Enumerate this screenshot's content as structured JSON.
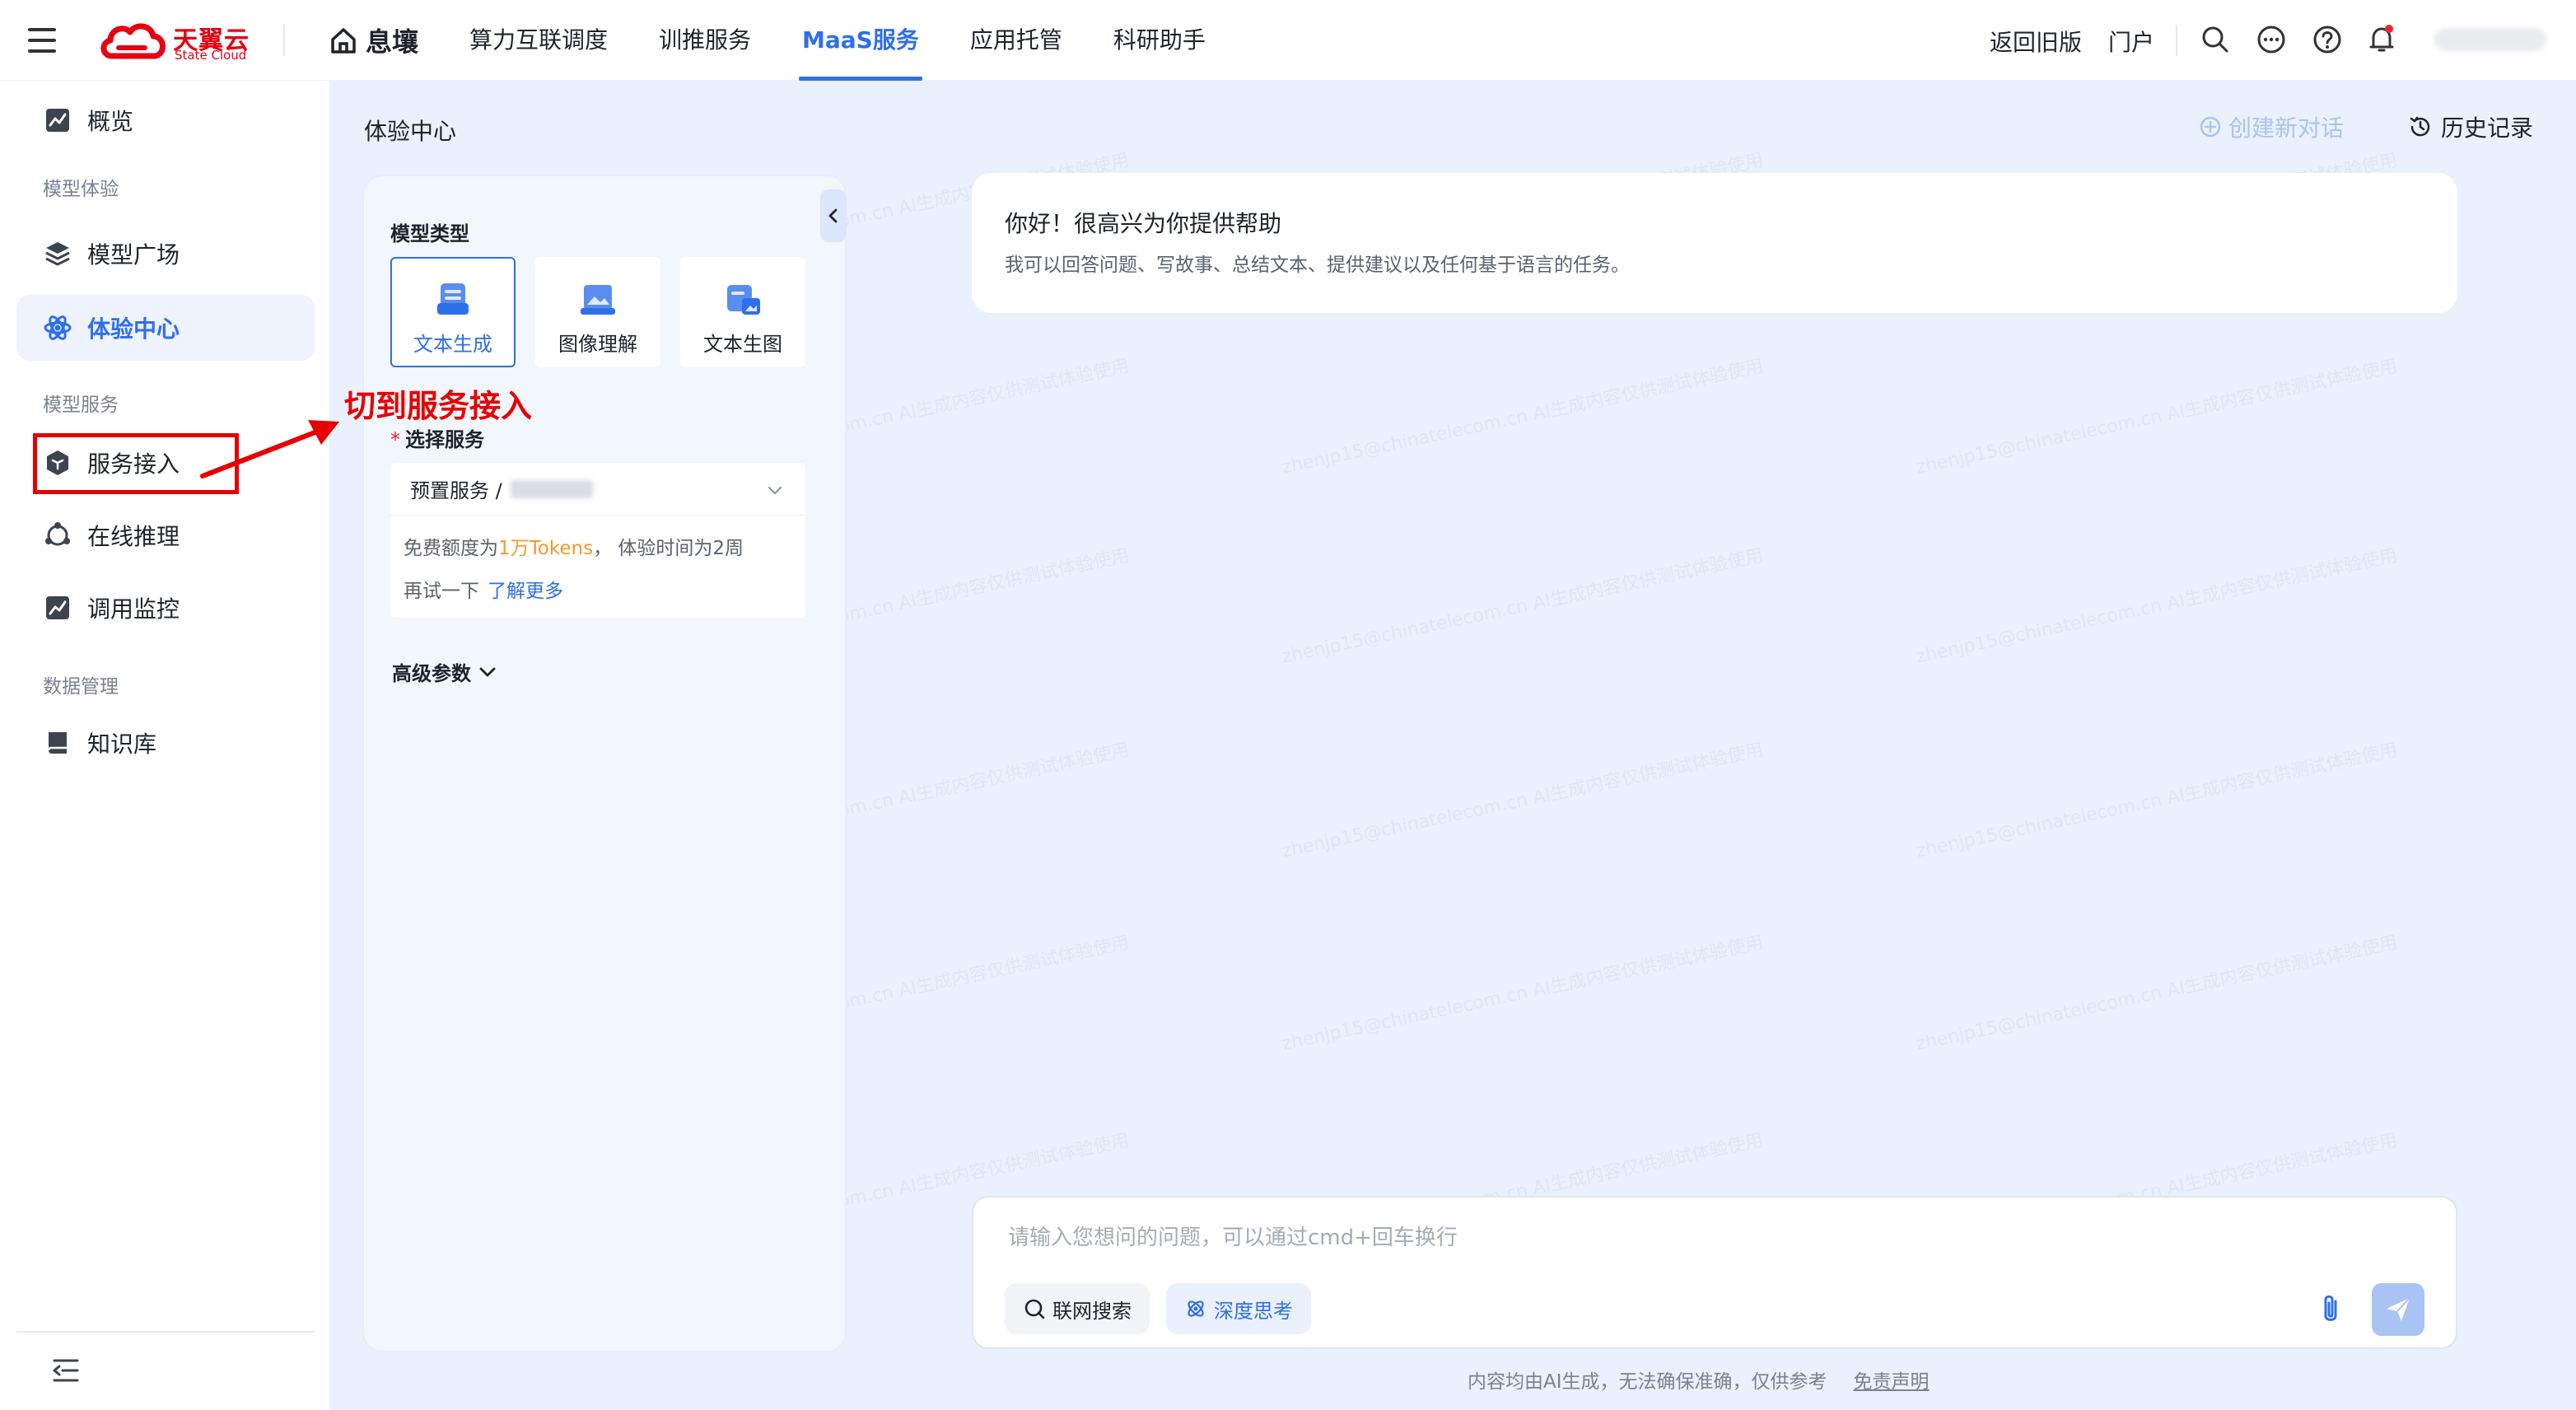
{
  "topbar": {
    "logo_name": "天翼云",
    "logo_sub": "State Cloud",
    "brand": "息壤",
    "nav": [
      "算力互联调度",
      "训推服务",
      "MaaS服务",
      "应用托管",
      "科研助手"
    ],
    "active_nav": "MaaS服务",
    "return_old": "返回旧版",
    "portal": "门户"
  },
  "sidebar": {
    "overview": "概览",
    "group_experience": "模型体验",
    "model_square": "模型广场",
    "experience_center": "体验中心",
    "group_service": "模型服务",
    "service_access": "服务接入",
    "online_inference": "在线推理",
    "call_monitor": "调用监控",
    "group_data": "数据管理",
    "knowledge_base": "知识库"
  },
  "annotation": {
    "text": "切到服务接入"
  },
  "main": {
    "title": "体验中心",
    "new_chat": "创建新对话",
    "history": "历史记录",
    "panel": {
      "model_type_label": "模型类型",
      "types": [
        "文本生成",
        "图像理解",
        "文本生图"
      ],
      "active_type": "文本生成",
      "select_service_label": "选择服务",
      "service_value": "预置服务 /",
      "quota_prefix": "免费额度为",
      "quota_amount": "1万Tokens",
      "quota_suffix": "， 体验时间为2周",
      "retry": "再试一下",
      "learn_more": "了解更多",
      "advanced": "高级参数"
    },
    "welcome": {
      "title": "你好！很高兴为你提供帮助",
      "subtitle": "我可以回答问题、写故事、总结文本、提供建议以及任何基于语言的任务。"
    },
    "input": {
      "placeholder": "请输入您想问的问题，可以通过cmd+回车换行",
      "web_search": "联网搜索",
      "deep_think": "深度思考"
    },
    "footer": {
      "note": "内容均由AI生成，无法确保准确，仅供参考",
      "disclaimer": "免责声明"
    },
    "watermark": "zhenjp15@chinatelecom.cn AI生成内容仅供测试体验使用"
  },
  "colors": {
    "primary": "#2e6fea",
    "brand_red": "#e60012",
    "annotation_red": "#e60000",
    "quota_orange": "#f29a2e",
    "main_bg": "#eaf1fc"
  }
}
